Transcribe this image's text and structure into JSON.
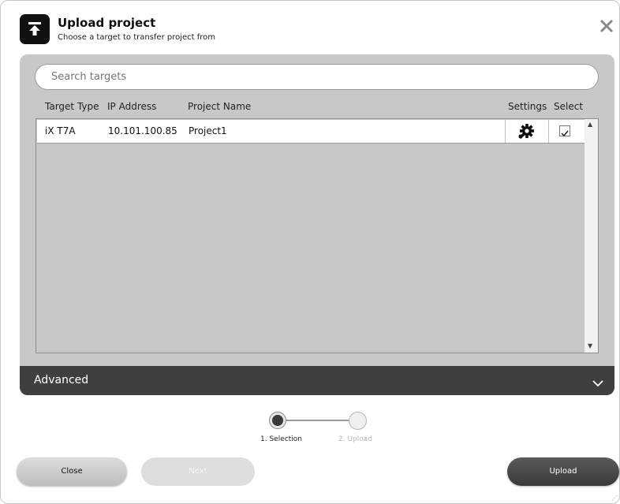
{
  "dialog": {
    "title": "Upload project",
    "subtitle": "Choose a target to transfer project from"
  },
  "search": {
    "placeholder": "Search targets"
  },
  "columns": {
    "target_type": "Target Type",
    "ip_address": "IP Address",
    "project_name": "Project Name",
    "settings": "Settings",
    "select": "Select"
  },
  "targets": [
    {
      "target_type": "iX T7A",
      "ip_address": "10.101.100.85",
      "project_name": "Project1",
      "selected": true
    }
  ],
  "advanced": {
    "label": "Advanced"
  },
  "steps": [
    {
      "label": "1. Selection",
      "state": "active"
    },
    {
      "label": "2. Upload",
      "state": "inactive"
    }
  ],
  "buttons": {
    "close": "Close",
    "next": "Next",
    "upload": "Upload"
  },
  "icons": [
    "upload-icon",
    "close-icon",
    "gear-icon",
    "checkbox-checked-icon",
    "chevron-down-icon",
    "scroll-up-icon",
    "scroll-down-icon",
    "resize-grip-icon"
  ],
  "colors": {
    "panel_bg": "#c8c8c8",
    "advanced_bar": "#3f3f3f",
    "upload_button": "#4a4a4a",
    "step_active": "#3a3a3a"
  }
}
